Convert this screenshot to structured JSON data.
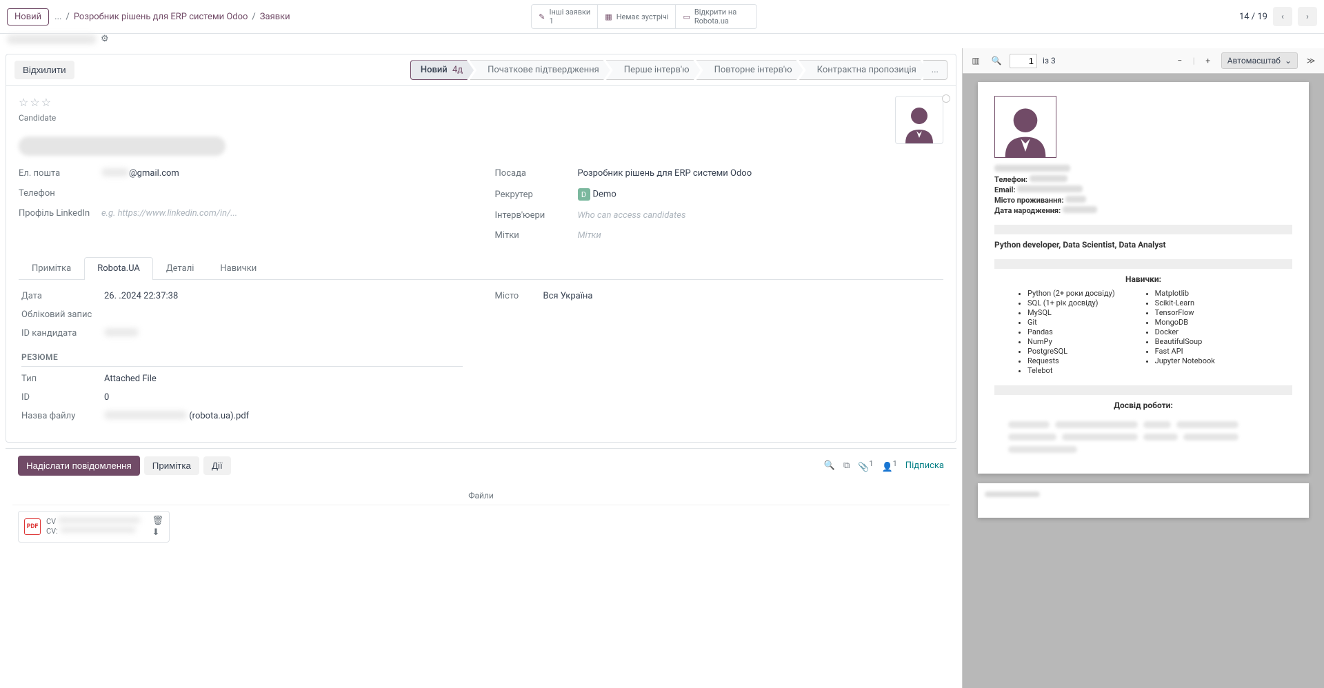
{
  "header": {
    "badge": "Новий",
    "ellipsis": "...",
    "crumb1": "Розробник рішень для ERP системи Odoo",
    "crumb2": "Заявки",
    "other_apps_label": "Інші заявки",
    "other_apps_count": "1",
    "no_meeting": "Немає зустрічі",
    "open_robota": "Відкрити на Robota.ua",
    "pager": "14 / 19"
  },
  "statusbar": {
    "refuse": "Відхилити",
    "stages": {
      "new": "Новий",
      "new_days": "4д",
      "s2": "Початкове підтвердження",
      "s3": "Перше інтерв'ю",
      "s4": "Повторне інтерв'ю",
      "s5": "Контрактна пропозиція",
      "more": "..."
    }
  },
  "form": {
    "candidate_label": "Candidate",
    "left": {
      "email_label": "Ел. пошта",
      "email_value": "@gmail.com",
      "phone_label": "Телефон",
      "linkedin_label": "Профіль LinkedIn",
      "linkedin_placeholder": "e.g. https://www.linkedin.com/in/..."
    },
    "right": {
      "position_label": "Посада",
      "position_value": "Розробник рішень для ERP системи Odoo",
      "recruiter_label": "Рекрутер",
      "recruiter_initial": "D",
      "recruiter_value": "Demo",
      "interviewers_label": "Інтерв'юери",
      "interviewers_placeholder": "Who can access candidates",
      "tags_label": "Мітки",
      "tags_placeholder": "Мітки"
    }
  },
  "tabs": {
    "t1": "Примітка",
    "t2": "Robota.UA",
    "t3": "Деталі",
    "t4": "Навички"
  },
  "robota": {
    "date_label": "Дата",
    "date_value": "26.  .2024 22:37:38",
    "city_label": "Місто",
    "city_value": "Вся Україна",
    "account_label": "Обліковий запис",
    "candidate_id_label": "ID кандидата",
    "resume_head": "РЕЗЮМЕ",
    "type_label": "Тип",
    "type_value": "Attached File",
    "id_label": "ID",
    "id_value": "0",
    "filename_label": "Назва файлу",
    "filename_value": " (robota.ua).pdf"
  },
  "chatter": {
    "send": "Надіслати повідомлення",
    "note": "Примітка",
    "actions": "Дії",
    "attach_count": "1",
    "follow_count": "1",
    "subscribe": "Підписка",
    "files": "Файли",
    "file_prefix1": "CV",
    "file_prefix2": "CV:"
  },
  "pdf": {
    "page_current": "1",
    "page_total": "із 3",
    "zoom": "Автомасштаб",
    "cv": {
      "phone_label": "Телефон:",
      "email_label": "Email:",
      "city_label": "Місто проживання:",
      "dob_label": "Дата народження:",
      "title": "Python developer, Data Scientist,  Data Analyst",
      "skills_head": "Навички:",
      "skills_left": [
        "Python   (2+ роки досвіду)",
        "SQL      (1+ рік досвіду)",
        "MySQL",
        "Git",
        "Pandas",
        "NumPy",
        "PostgreSQL",
        "Requests",
        "Telebot"
      ],
      "skills_right": [
        "Matplotlib",
        "Scikit-Learn",
        "TensorFlow",
        "MongoDB",
        "Docker",
        "BeautifulSoup",
        "Fast API",
        "Jupyter Notebook"
      ],
      "exp_head": "Досвід роботи:"
    }
  }
}
